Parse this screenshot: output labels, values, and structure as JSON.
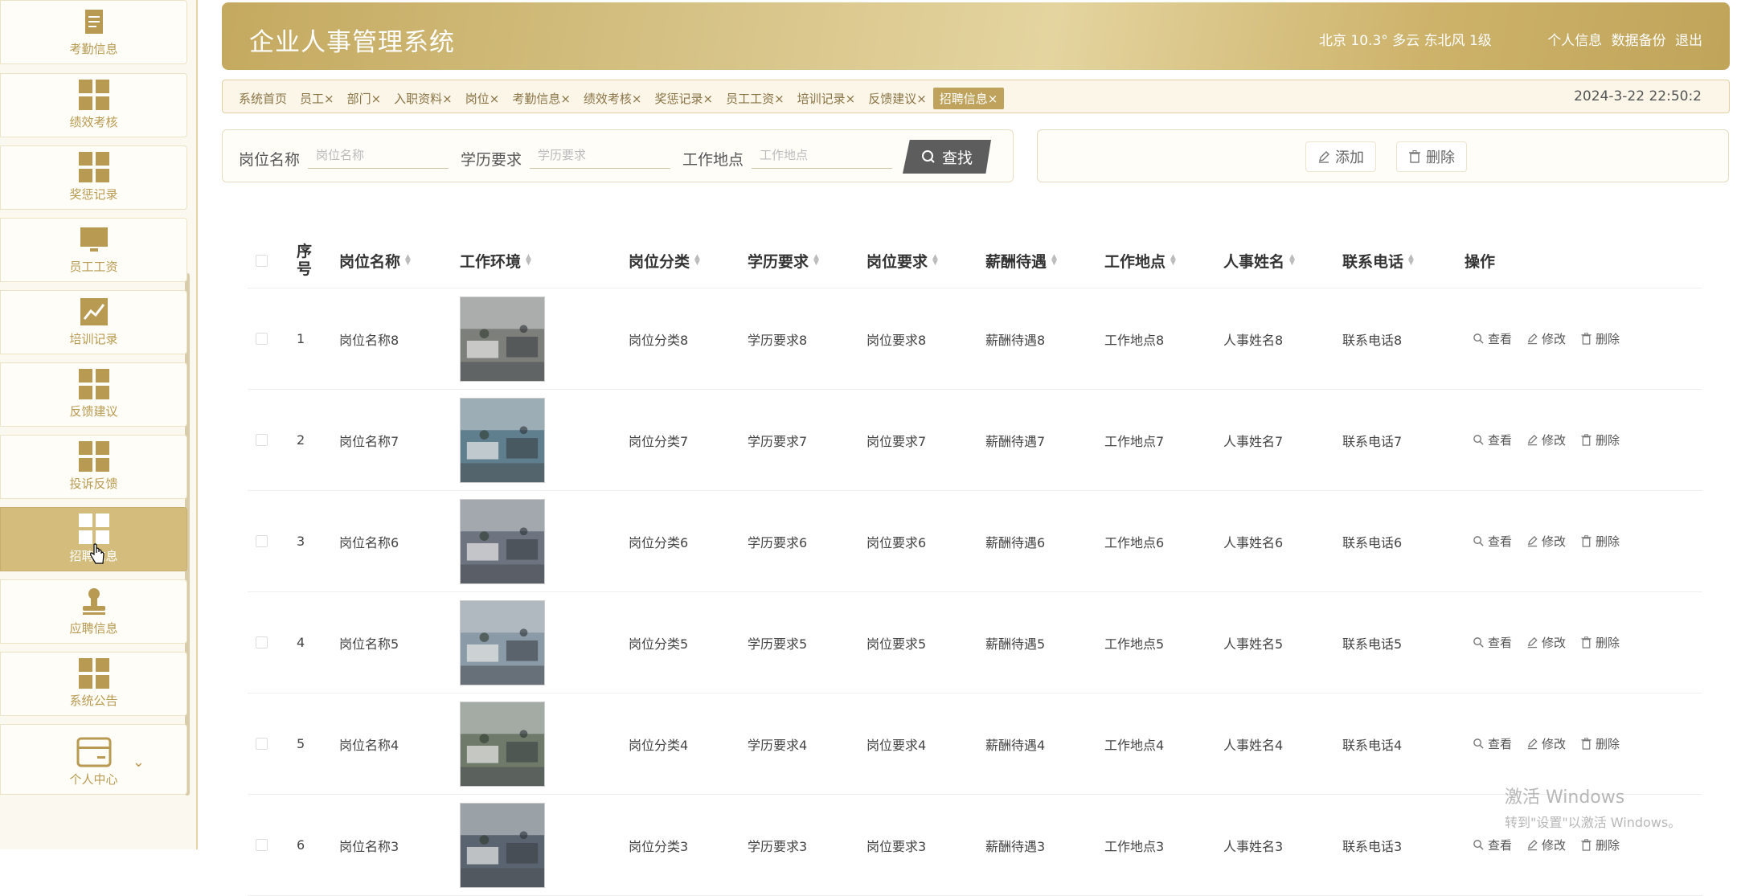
{
  "sidebar": {
    "items": [
      {
        "label": "考勤信息",
        "icon": "clipboard-icon"
      },
      {
        "label": "绩效考核",
        "icon": "grid-icon"
      },
      {
        "label": "奖惩记录",
        "icon": "grid-icon"
      },
      {
        "label": "员工工资",
        "icon": "monitor-icon"
      },
      {
        "label": "培训记录",
        "icon": "chart-icon"
      },
      {
        "label": "反馈建议",
        "icon": "grid-icon"
      },
      {
        "label": "投诉反馈",
        "icon": "grid-icon"
      },
      {
        "label": "招聘信息",
        "icon": "grid-icon",
        "active": true
      },
      {
        "label": "应聘信息",
        "icon": "stamp-icon"
      },
      {
        "label": "系统公告",
        "icon": "grid-icon"
      },
      {
        "label": "个人中心",
        "icon": "card-icon"
      }
    ],
    "expand_glyph": "⌄"
  },
  "header": {
    "title": "企业人事管理系统",
    "weather": "北京 10.3° 多云 东北风 1级",
    "links": [
      "个人信息",
      "数据备份",
      "退出"
    ]
  },
  "tabs": {
    "items": [
      "系统首页",
      "员工×",
      "部门×",
      "入职资料×",
      "岗位×",
      "考勤信息×",
      "绩效考核×",
      "奖惩记录×",
      "员工工资×",
      "培训记录×",
      "反馈建议×",
      "招聘信息×"
    ],
    "datetime": "2024-3-22 22:50:2"
  },
  "search": {
    "label1": "岗位名称",
    "placeholder1": "岗位名称",
    "label2": "学历要求",
    "placeholder2": "学历要求",
    "label3": "工作地点",
    "placeholder3": "工作地点",
    "button": "查找"
  },
  "actions": {
    "add": "添加",
    "delete": "删除"
  },
  "table": {
    "headers": [
      "序\n号",
      "岗位名称",
      "工作环境",
      "岗位分类",
      "学历要求",
      "岗位要求",
      "薪酬待遇",
      "工作地点",
      "人事姓名",
      "联系电话",
      "操作"
    ],
    "ops": [
      "查看",
      "修改",
      "删除"
    ],
    "rows": [
      {
        "no": "1",
        "name": "岗位名称8",
        "cat": "岗位分类8",
        "edu": "学历要求8",
        "req": "岗位要求8",
        "pay": "薪酬待遇8",
        "loc": "工作地点8",
        "hr": "人事姓名8",
        "tel": "联系电话8",
        "tone": "#7d7f7a"
      },
      {
        "no": "2",
        "name": "岗位名称7",
        "cat": "岗位分类7",
        "edu": "学历要求7",
        "req": "岗位要求7",
        "pay": "薪酬待遇7",
        "loc": "工作地点7",
        "hr": "人事姓名7",
        "tel": "联系电话7",
        "tone": "#5f7f8f"
      },
      {
        "no": "3",
        "name": "岗位名称6",
        "cat": "岗位分类6",
        "edu": "学历要求6",
        "req": "岗位要求6",
        "pay": "薪酬待遇6",
        "loc": "工作地点6",
        "hr": "人事姓名6",
        "tel": "联系电话6",
        "tone": "#6d7480"
      },
      {
        "no": "4",
        "name": "岗位名称5",
        "cat": "岗位分类5",
        "edu": "学历要求5",
        "req": "岗位要求5",
        "pay": "薪酬待遇5",
        "loc": "工作地点5",
        "hr": "人事姓名5",
        "tel": "联系电话5",
        "tone": "#8a9aa6"
      },
      {
        "no": "5",
        "name": "岗位名称4",
        "cat": "岗位分类4",
        "edu": "学历要求4",
        "req": "岗位要求4",
        "pay": "薪酬待遇4",
        "loc": "工作地点4",
        "hr": "人事姓名4",
        "tel": "联系电话4",
        "tone": "#6f7a6a"
      },
      {
        "no": "6",
        "name": "岗位名称3",
        "cat": "岗位分类3",
        "edu": "学历要求3",
        "req": "岗位要求3",
        "pay": "薪酬待遇3",
        "loc": "工作地点3",
        "hr": "人事姓名3",
        "tel": "联系电话3",
        "tone": "#5a6470"
      }
    ]
  },
  "watermark": {
    "line1": "激活 Windows",
    "line2": "转到\"设置\"以激活 Windows。"
  },
  "colors": {
    "accent": "#bfa35c",
    "header_gold": "#d4bd7c",
    "active_tab": "#bfa35c"
  }
}
